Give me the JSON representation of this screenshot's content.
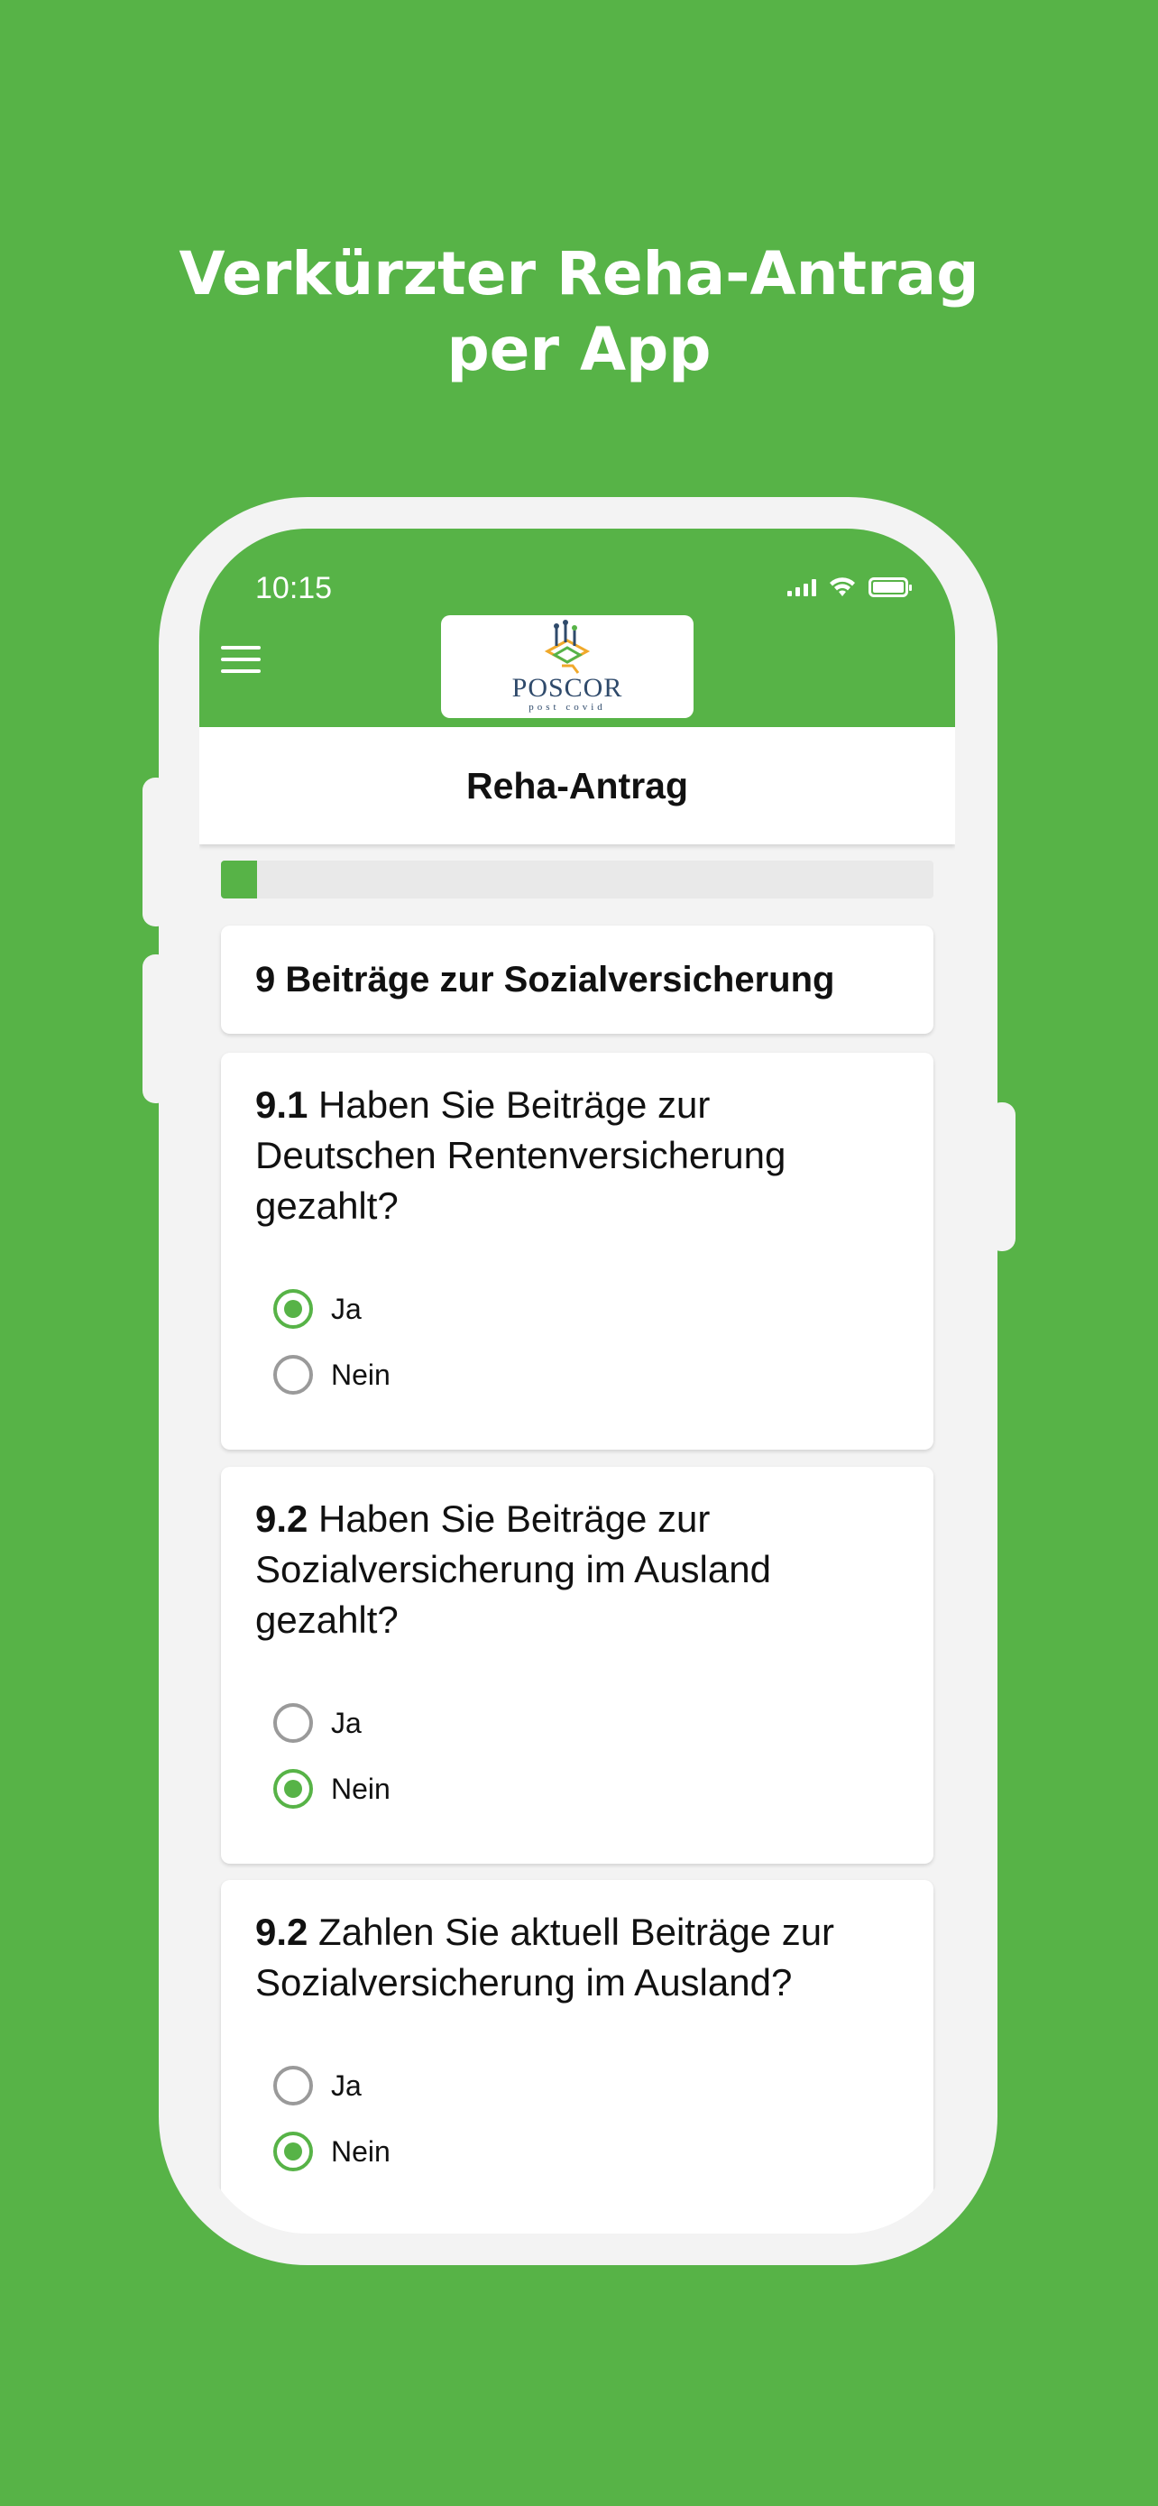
{
  "headline": {
    "line1": "Verkürzter Reha-Antrag",
    "line2": "per App"
  },
  "status_bar": {
    "time": "10:15"
  },
  "brand": {
    "name": "POSCOR",
    "tagline": "post covid"
  },
  "page": {
    "title": "Reha-Antrag"
  },
  "progress": {
    "fraction": 0.05
  },
  "section": {
    "title": "9 Beiträge zur Sozialversicherung"
  },
  "questions": [
    {
      "number": "9.1",
      "text": " Haben Sie Beiträge zur Deutschen Rentenversicherung gezahlt?",
      "options": [
        {
          "label": "Ja",
          "selected": true
        },
        {
          "label": "Nein",
          "selected": false
        }
      ]
    },
    {
      "number": "9.2",
      "text": " Haben Sie Beiträge zur Sozialversicherung im Ausland gezahlt?",
      "options": [
        {
          "label": "Ja",
          "selected": false
        },
        {
          "label": "Nein",
          "selected": true
        }
      ]
    },
    {
      "number": "9.2",
      "text": " Zahlen Sie aktuell Beiträge zur Sozialversicherung im Ausland?",
      "options": [
        {
          "label": "Ja",
          "selected": false
        },
        {
          "label": "Nein",
          "selected": true
        }
      ]
    }
  ],
  "colors": {
    "brand_green": "#57b347",
    "radio_off": "#9a9a9a"
  },
  "icons": [
    "hamburger-menu-icon",
    "signal-icon",
    "wifi-icon",
    "battery-icon",
    "radio-selected-icon",
    "radio-unselected-icon"
  ]
}
